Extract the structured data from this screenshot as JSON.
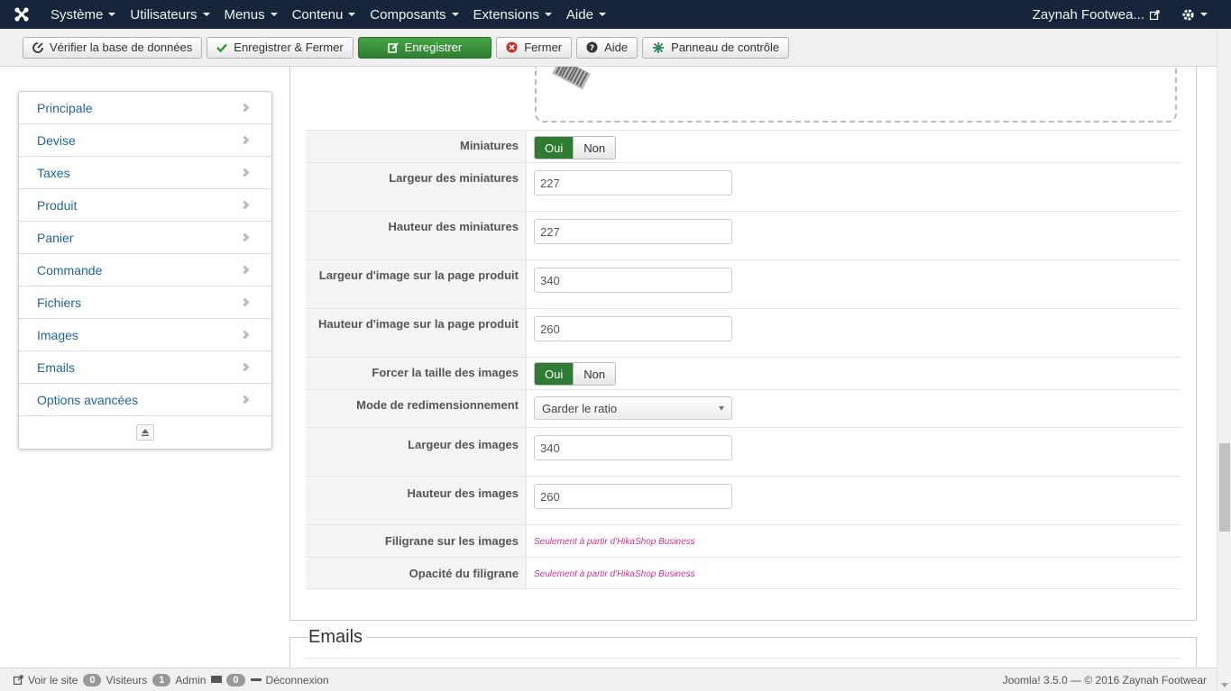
{
  "navbar": {
    "menus": [
      "Système",
      "Utilisateurs",
      "Menus",
      "Contenu",
      "Composants",
      "Extensions",
      "Aide"
    ],
    "site_name": "Zaynah Footwea..."
  },
  "toolbar": {
    "check_db": "Vérifier la base de données",
    "save_close": "Enregistrer & Fermer",
    "save": "Enregistrer",
    "close": "Fermer",
    "help": "Aide",
    "control_panel": "Panneau de contrôle"
  },
  "sidebar": {
    "items": [
      "Principale",
      "Devise",
      "Taxes",
      "Produit",
      "Panier",
      "Commande",
      "Fichiers",
      "Images",
      "Emails",
      "Options avancées"
    ]
  },
  "form": {
    "thumbnails_label": "Miniatures",
    "thumbnails_on": "Oui",
    "thumbnails_off": "Non",
    "thumb_width_label": "Largeur des miniatures",
    "thumb_width_value": "227",
    "thumb_height_label": "Hauteur des miniatures",
    "thumb_height_value": "227",
    "product_img_width_label": "Largeur d'image sur la page produit",
    "product_img_width_value": "340",
    "product_img_height_label": "Hauteur d'image sur la page produit",
    "product_img_height_value": "260",
    "force_size_label": "Forcer la taille des images",
    "force_size_on": "Oui",
    "force_size_off": "Non",
    "resize_mode_label": "Mode de redimensionnement",
    "resize_mode_value": "Garder le ratio",
    "img_width_label": "Largeur des images",
    "img_width_value": "340",
    "img_height_label": "Hauteur des images",
    "img_height_value": "260",
    "watermark_label": "Filigrane sur les images",
    "watermark_note": "Seulement à partir d'HikaShop Business",
    "watermark_opacity_label": "Opacité du filigrane",
    "watermark_opacity_note": "Seulement à partir d'HikaShop Business"
  },
  "section": {
    "emails_title": "Emails"
  },
  "statusbar": {
    "view_site": "Voir le site",
    "visitors_count": "0",
    "visitors_label": "Visiteurs",
    "admin_count": "1",
    "admin_label": "Admin",
    "messages_count": "0",
    "logout": "Déconnexion",
    "version": "Joomla! 3.5.0 — © 2016 Zaynah Footwear"
  },
  "colors": {
    "navbar_bg": "#17243a",
    "success": "#2e7b32",
    "link": "#23649c",
    "note": "#c9348f"
  },
  "icons": [
    "joomla-logo-icon",
    "external-link-icon",
    "gear-icon",
    "database-icon",
    "check-icon",
    "edit-icon",
    "close-circle-icon",
    "question-icon",
    "control-panel-icon",
    "chevron-right-icon",
    "collapse-icon",
    "select-caret-icon",
    "comment-icon",
    "minus-icon"
  ]
}
